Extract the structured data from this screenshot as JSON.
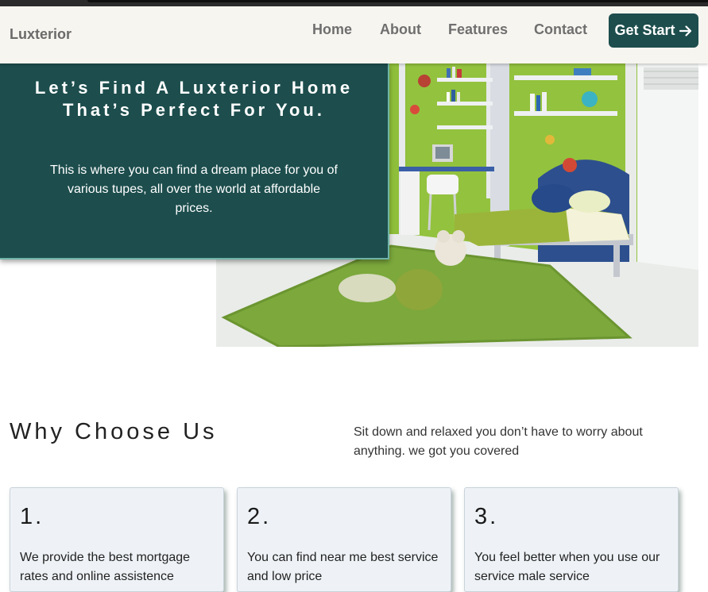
{
  "navbar": {
    "brand": "Luxterior",
    "links": [
      "Home",
      "About",
      "Features",
      "Contact"
    ],
    "cta_label": "Get Start",
    "cta_icon": "arrow-right-icon"
  },
  "hero": {
    "title": "Let’s Find A Luxterior Home That’s Perfect For You.",
    "text": "This is where you can find a dream place for you of various tupes, all over the world at affordable prices.",
    "image": "kids-bedroom-photo"
  },
  "why": {
    "title": "Why Choose Us",
    "text": "Sit down and relaxed you don’t have to worry about anything. we got you covered"
  },
  "cards": [
    {
      "num": "1.",
      "text": "We provide the best mortgage rates and online assistence"
    },
    {
      "num": "2.",
      "text": "You can find near me best service and low price"
    },
    {
      "num": "3.",
      "text": "You feel better when you use our service male service"
    }
  ],
  "colors": {
    "primary": "#1d4d4d",
    "accent_border": "#6fb3a8",
    "navbar_bg": "#f7f5f0",
    "card_bg": "#eef2f6"
  }
}
